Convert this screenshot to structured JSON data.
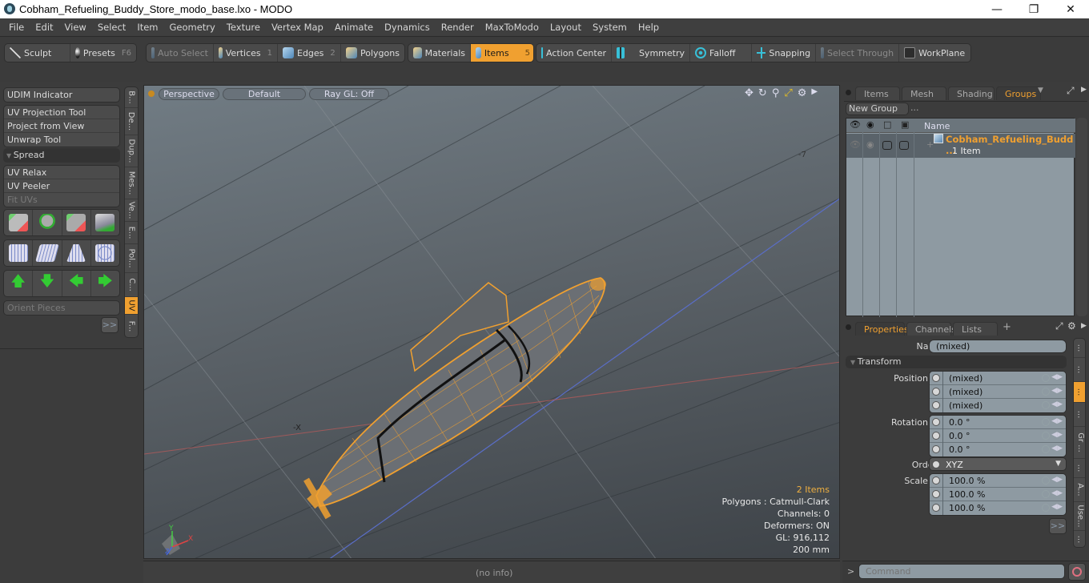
{
  "window": {
    "title": "Cobham_Refueling_Buddy_Store_modo_base.lxo - MODO",
    "controls": [
      "minimize",
      "maximize",
      "close"
    ]
  },
  "menu": [
    "File",
    "Edit",
    "View",
    "Select",
    "Item",
    "Geometry",
    "Texture",
    "Vertex Map",
    "Animate",
    "Dynamics",
    "Render",
    "MaxToModo",
    "Layout",
    "System",
    "Help"
  ],
  "toolbar": {
    "sculpt": "Sculpt",
    "presets": "Presets",
    "presets_key": "F6",
    "auto_select": "Auto Select",
    "vertices": "Vertices",
    "vertices_key": "1",
    "edges": "Edges",
    "edges_key": "2",
    "polygons": "Polygons",
    "materials": "Materials",
    "items": "Items",
    "items_key": "5",
    "action_center": "Action Center",
    "symmetry": "Symmetry",
    "falloff": "Falloff",
    "snapping": "Snapping",
    "select_through": "Select Through",
    "workplane": "WorkPlane"
  },
  "left_panel": {
    "udim": "UDIM Indicator",
    "group1": [
      "UV Projection Tool",
      "Project from View",
      "Unwrap Tool"
    ],
    "spread": "Spread",
    "group2": [
      "UV Relax",
      "UV Peeler",
      "Fit UVs"
    ],
    "orient": "Orient Pieces",
    "more": ">>",
    "vtabs": [
      "B...",
      "De...",
      "Dup...",
      "Mes...",
      "Ve...",
      "E...",
      "Pol...",
      "C...",
      "UV",
      "F..."
    ],
    "active_vtab": "UV"
  },
  "viewport": {
    "view_mode": "Perspective",
    "shading": "Default",
    "raygl": "Ray GL: Off",
    "info": {
      "items": "2 Items",
      "polygons": "Polygons : Catmull-Clark",
      "channels": "Channels: 0",
      "deformers": "Deformers: ON",
      "gl": "GL: 916,112",
      "scale": "200 mm"
    },
    "grid_label_neg7": "-7",
    "axis_labels": {
      "x": "X",
      "y": "Y",
      "z": "Z"
    }
  },
  "status": {
    "info": "(no info)"
  },
  "items_panel": {
    "tabs": [
      "Items",
      "Mesh ...",
      "Shading",
      "Groups"
    ],
    "active_tab": "Groups",
    "new_group": "New Group",
    "col_name": "Name",
    "group_name": "Cobham_Refueling_Budd ...",
    "group_count": "1 Item"
  },
  "properties": {
    "tabs": [
      "Properties",
      "Channels",
      "Lists"
    ],
    "active_tab": "Properties",
    "add_tab": "+",
    "name_label": "Name",
    "name_value": "(mixed)",
    "section": "Transform",
    "position": {
      "label": "Position X",
      "x": "(mixed)",
      "y": "(mixed)",
      "z": "(mixed)"
    },
    "rotation": {
      "label": "Rotation X",
      "x": "0.0 °",
      "y": "0.0 °",
      "z": "0.0 °"
    },
    "order": {
      "label": "Order",
      "value": "XYZ"
    },
    "scale": {
      "label": "Scale X",
      "x": "100.0 %",
      "y": "100.0 %",
      "z": "100.0 %"
    },
    "axis_y": "Y",
    "axis_z": "Z",
    "more": ">>",
    "side_tabs": [
      "...",
      "...",
      "...",
      "...",
      "Gr ...",
      "...",
      "A...",
      "Use...",
      "..."
    ]
  },
  "command": {
    "prompt": ">",
    "placeholder": "Command"
  },
  "colors": {
    "accent": "#f0a030",
    "panel": "#3c3c3c",
    "field": "#8e9aa2"
  }
}
